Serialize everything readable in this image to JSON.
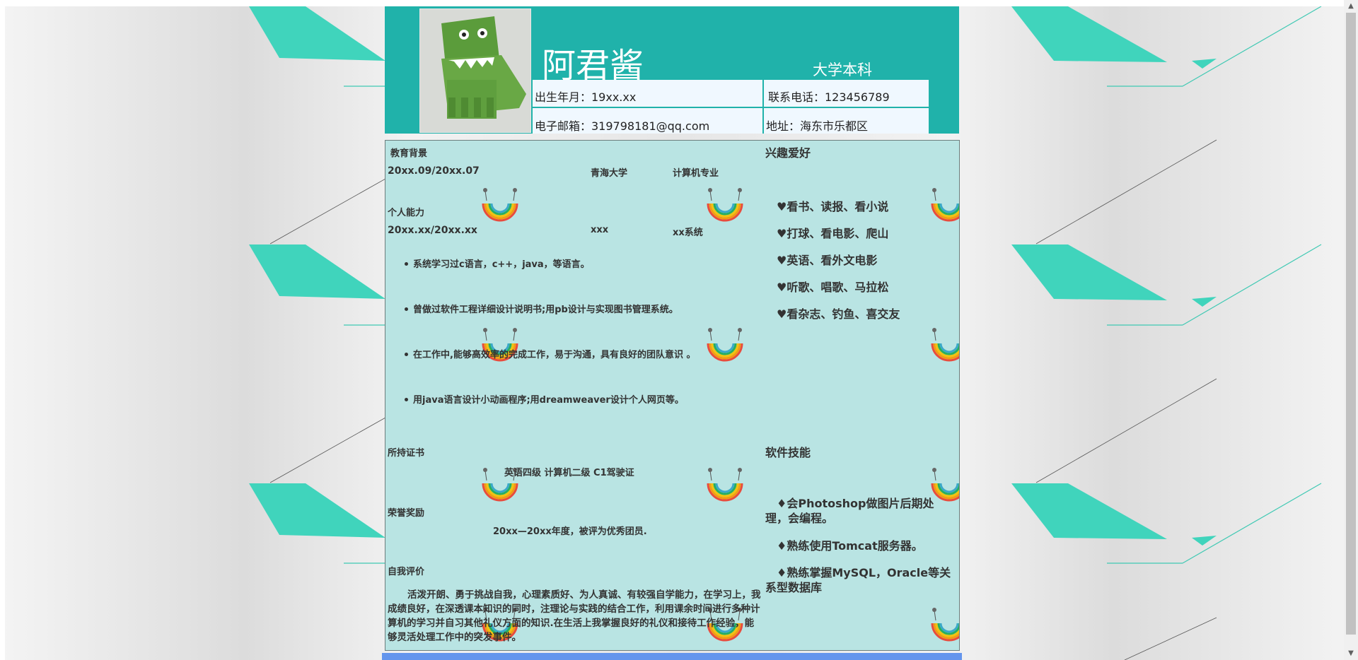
{
  "header": {
    "name": "阿君酱",
    "degree": "大学本科",
    "birth": "出生年月：19xx.xx",
    "phone": "联系电话：123456789",
    "email": "电子邮箱：319798181@qq.com",
    "address": "地址：海东市乐都区"
  },
  "education": {
    "heading": "教育背景",
    "period": "20xx.09/20xx.07",
    "school": "青海大学",
    "major": "计算机专业"
  },
  "ability": {
    "heading": "个人能力",
    "period": "20xx.xx/20xx.xx",
    "org": "xxx",
    "dept": "xx系统",
    "bullets": [
      "系统学习过c语言，c++，java，等语言。",
      "曾做过软件工程详细设计说明书;用pb设计与实现图书管理系统。",
      "在工作中,能够高效率的完成工作，易于沟通，具有良好的团队意识 。",
      "用java语言设计小动画程序;用dreamweaver设计个人网页等。"
    ]
  },
  "certificates": {
    "heading": "所持证书",
    "content": "英语四级 计算机二级 C1驾驶证"
  },
  "honors": {
    "heading": "荣誉奖励",
    "content": "20xx—20xx年度，被评为优秀团员."
  },
  "self_eval": {
    "heading": "自我评价",
    "content": "活泼开朗、勇于挑战自我，心理素质好、为人真诚、有较强自学能力，在学习上，我成绩良好，在深透课本知识的同时，注理论与实践的结合工作，利用课余时间进行多种计算机的学习并自习其他礼仪方面的知识.在生活上我掌握良好的礼仪和接待工作经验，能够灵活处理工作中的突发事件。"
  },
  "hobbies": {
    "heading": "兴趣爱好",
    "items": [
      "♥看书、读报、看小说",
      "♥打球、看电影、爬山",
      "♥英语、看外文电影",
      "♥听歌、唱歌、马拉松",
      "♥看杂志、钓鱼、喜交友"
    ]
  },
  "skills": {
    "heading": "软件技能",
    "items": [
      "♦会Photoshop做图片后期处理，会编程。",
      "♦熟练使用Tomcat服务器。",
      "♦熟练掌握MySQL，Oracle等关系型数据库"
    ]
  },
  "colors": {
    "header_bg": "#20b2aa",
    "panel_bg": "#b9e4e3",
    "info_cell_bg": "#f0f8ff",
    "footer_bar": "#6495ed",
    "deco_teal": "#40d4bc"
  }
}
